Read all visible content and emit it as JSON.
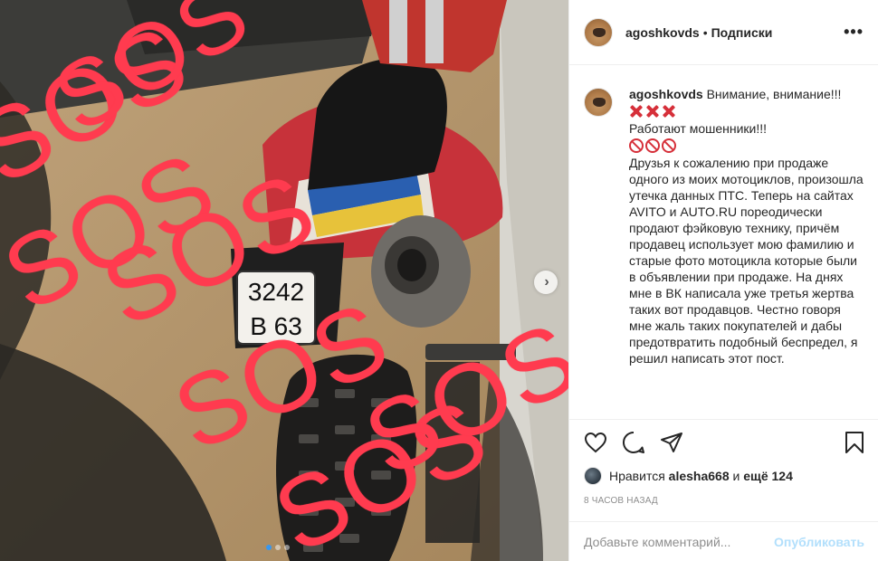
{
  "header": {
    "username": "agoshkovds",
    "separator": "•",
    "follow_label": "Подписки",
    "more_label": "•••"
  },
  "media": {
    "overlay_text": "SOS",
    "plate_line1": "3242",
    "plate_line2": "B 63",
    "next_icon": "chevron-right-icon"
  },
  "caption": {
    "username": "agoshkovds",
    "line1": "Внимание, внимание!!!",
    "emoji1": "cross-mark-emoji x3",
    "line2": "Работают мошенники!!!",
    "emoji2": "prohibited-emoji x3",
    "body": "Друзья к сожалению при продаже одного из моих мотоциклов, произошла утечка данных ПТС. Теперь на сайтах AVITO и AUTO.RU пореодически продают фэйковую технику, причём продавец использует мою фамилию и старые фото мотоцикла которые были в объявлении при продаже. На днях мне в ВК написала уже третья жертва таких вот продавцов. Честно говоря мне жаль таких покупателей и дабы предотвратить подобный беспредел, я решил написать этот пост."
  },
  "likes": {
    "prefix": "Нравится",
    "user": "alesha668",
    "middle": "и",
    "more": "ещё 124"
  },
  "time_ago": "8 ЧАСОВ НАЗАД",
  "comment_box": {
    "placeholder": "Добавьте комментарий...",
    "publish_label": "Опубликовать"
  },
  "colors": {
    "sos_red": "#ff3b4f",
    "publish_blue": "#b2dffc",
    "dot_active": "#3897f0"
  }
}
